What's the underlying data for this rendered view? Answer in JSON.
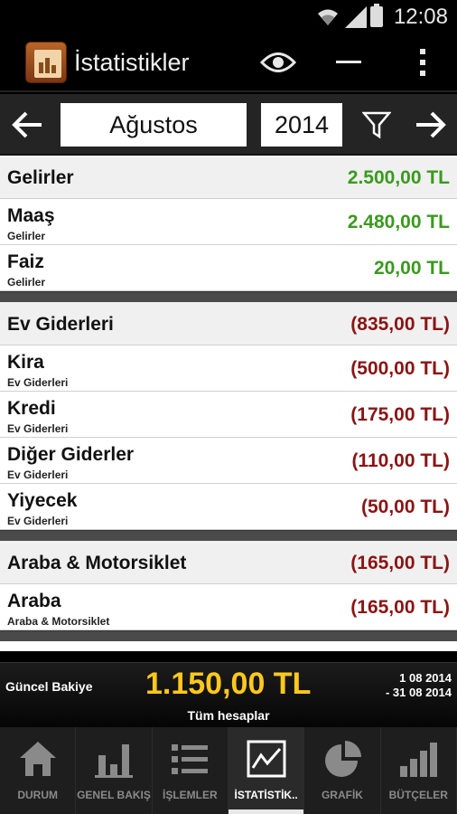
{
  "status_bar": {
    "time": "12:08"
  },
  "app": {
    "title": "İstatistikler"
  },
  "period": {
    "month": "Ağustos",
    "year": "2014"
  },
  "groups": [
    {
      "name": "Gelirler",
      "total": "2.500,00 TL",
      "items": [
        {
          "name": "Maaş",
          "category": "Gelirler",
          "amount": "2.480,00 TL"
        },
        {
          "name": "Faiz",
          "category": "Gelirler",
          "amount": "20,00 TL"
        }
      ]
    },
    {
      "name": "Ev Giderleri",
      "total": "(835,00 TL)",
      "items": [
        {
          "name": "Kira",
          "category": "Ev Giderleri",
          "amount": "(500,00 TL)"
        },
        {
          "name": "Kredi",
          "category": "Ev Giderleri",
          "amount": "(175,00 TL)"
        },
        {
          "name": "Diğer Giderler",
          "category": "Ev Giderleri",
          "amount": "(110,00 TL)"
        },
        {
          "name": "Yiyecek",
          "category": "Ev Giderleri",
          "amount": "(50,00 TL)"
        }
      ]
    },
    {
      "name": "Araba & Motorsiklet",
      "total": "(165,00 TL)",
      "items": [
        {
          "name": "Araba",
          "category": "Araba & Motorsiklet",
          "amount": "(165,00 TL)"
        }
      ]
    }
  ],
  "balance": {
    "label": "Güncel Bakiye",
    "value": "1.150,00 TL",
    "accounts": "Tüm hesaplar",
    "date_from": "1 08 2014",
    "date_to": "- 31 08 2014"
  },
  "nav": [
    {
      "label": "DURUM",
      "icon": "home-icon"
    },
    {
      "label": "GENEL BAKIŞ",
      "icon": "bar-chart-icon"
    },
    {
      "label": "İŞLEMLER",
      "icon": "list-icon"
    },
    {
      "label": "İSTATİSTİK..",
      "icon": "line-chart-icon",
      "active": true
    },
    {
      "label": "GRAFİK",
      "icon": "pie-chart-icon"
    },
    {
      "label": "BÜTÇELER",
      "icon": "budget-bars-icon"
    }
  ],
  "colors": {
    "income": "#3a9a1e",
    "expense": "#8a1414",
    "balance": "#ffc81d"
  }
}
